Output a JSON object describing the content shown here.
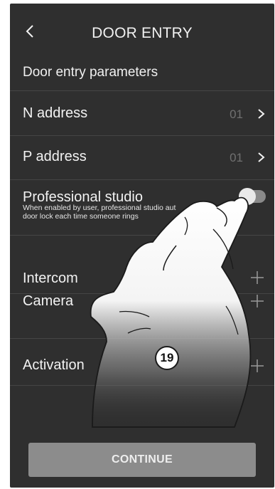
{
  "header": {
    "title": "DOOR ENTRY"
  },
  "section": {
    "title": "Door entry parameters"
  },
  "rows": [
    {
      "label": "N address",
      "value": "01"
    },
    {
      "label": "P address",
      "value": "01"
    }
  ],
  "professional_studio": {
    "label": "Professional studio",
    "description_line1": "When enabled by user, professional studio aut",
    "description_line2": "door lock each time someone rings",
    "enabled": false
  },
  "expandables": [
    {
      "label": "Intercom"
    },
    {
      "label": "Camera"
    },
    {
      "label": "Activation"
    }
  ],
  "step_marker": "19",
  "continue_label": "CONTINUE"
}
